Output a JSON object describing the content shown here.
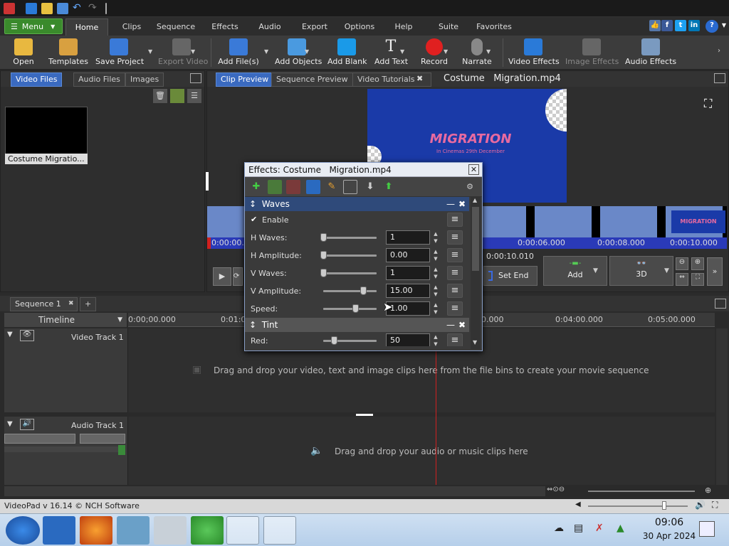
{
  "titlebar": {
    "quick_icons": [
      "app-icon",
      "new-project-icon",
      "open-folder-icon",
      "save-icon",
      "undo-icon",
      "redo-icon"
    ]
  },
  "ribbon": {
    "menu_label": "Menu",
    "tabs": [
      "Home",
      "Clips",
      "Sequence",
      "Effects",
      "Audio",
      "Export",
      "Options",
      "Help",
      "Suite",
      "Favorites"
    ],
    "active_tab": "Home",
    "social_icons": [
      "thumbs-up-icon",
      "facebook-icon",
      "twitter-icon",
      "linkedin-icon"
    ],
    "help_icon": "?"
  },
  "toolbar": {
    "open": "Open",
    "templates": "Templates",
    "save_project": "Save Project",
    "export_video": "Export Video",
    "add_files": "Add File(s)",
    "add_objects": "Add Objects",
    "add_blank": "Add Blank",
    "add_text": "Add Text",
    "record": "Record",
    "narrate": "Narrate",
    "video_effects": "Video Effects",
    "image_effects": "Image Effects",
    "audio_effects": "Audio Effects"
  },
  "bins": {
    "tabs": [
      "Video Files",
      "Audio Files",
      "Images"
    ],
    "active": "Video Files",
    "clip_label": "Costume   Migratio..."
  },
  "preview": {
    "tabs": [
      "Clip Preview",
      "Sequence Preview",
      "Video Tutorials"
    ],
    "active": "Clip Preview",
    "clip_title": "Costume   Migration.mp4",
    "video_text": "MIGRATION",
    "video_subtext": "In Cinemas 29th December",
    "time_start": "0:00:00.0",
    "time_mid": "0:00:06.000",
    "time_mid2": "0:00:08.000",
    "time_end": "0:00:10.000",
    "duration": "0:00:10.010",
    "set_end": "Set End",
    "add": "Add",
    "three_d": "3D",
    "clip_thumb_text": "MIGRATION"
  },
  "effects_dialog": {
    "title": "Effects: Costume   Migration.mp4",
    "waves": {
      "name": "Waves",
      "enable_label": "Enable",
      "enabled": true,
      "params": [
        {
          "label": "H Waves:",
          "value": "1",
          "level": 0.0
        },
        {
          "label": "H Amplitude:",
          "value": "0.00",
          "level": 0.0
        },
        {
          "label": "V Waves:",
          "value": "1",
          "level": 0.0
        },
        {
          "label": "V Amplitude:",
          "value": "15.00",
          "level": 0.75
        },
        {
          "label": "Speed:",
          "value": "1.00",
          "level": 0.6
        }
      ]
    },
    "tint": {
      "name": "Tint",
      "params": [
        {
          "label": "Red:",
          "value": "50",
          "level": 0.2
        }
      ]
    }
  },
  "sequence": {
    "tab": "Sequence 1",
    "add_tab": "+",
    "timeline_label": "Timeline",
    "ruler": [
      "0:00;00.000",
      "0:01:0",
      "0.000",
      "0:04:00.000",
      "0:05:00.000"
    ],
    "video_track": "Video Track 1",
    "video_hint": "Drag and drop your video, text and image clips here from the file bins to create your movie sequence",
    "audio_track": "Audio Track 1",
    "audio_hint": "Drag and drop your audio or music clips here"
  },
  "status": {
    "text": "VideoPad v 16.14 © NCH Software"
  },
  "taskbar": {
    "apps": [
      "start-orb",
      "file-explorer",
      "firefox",
      "control-panel",
      "recycle-bin",
      "cloud-app",
      "videopad",
      "wine-app"
    ],
    "time": "09:06",
    "date": "30 Apr 2024"
  },
  "colors": {
    "accent": "#3a6ac0",
    "menu_green": "#3a8a2c",
    "playhead": "#d02020",
    "record": "#e02020"
  }
}
